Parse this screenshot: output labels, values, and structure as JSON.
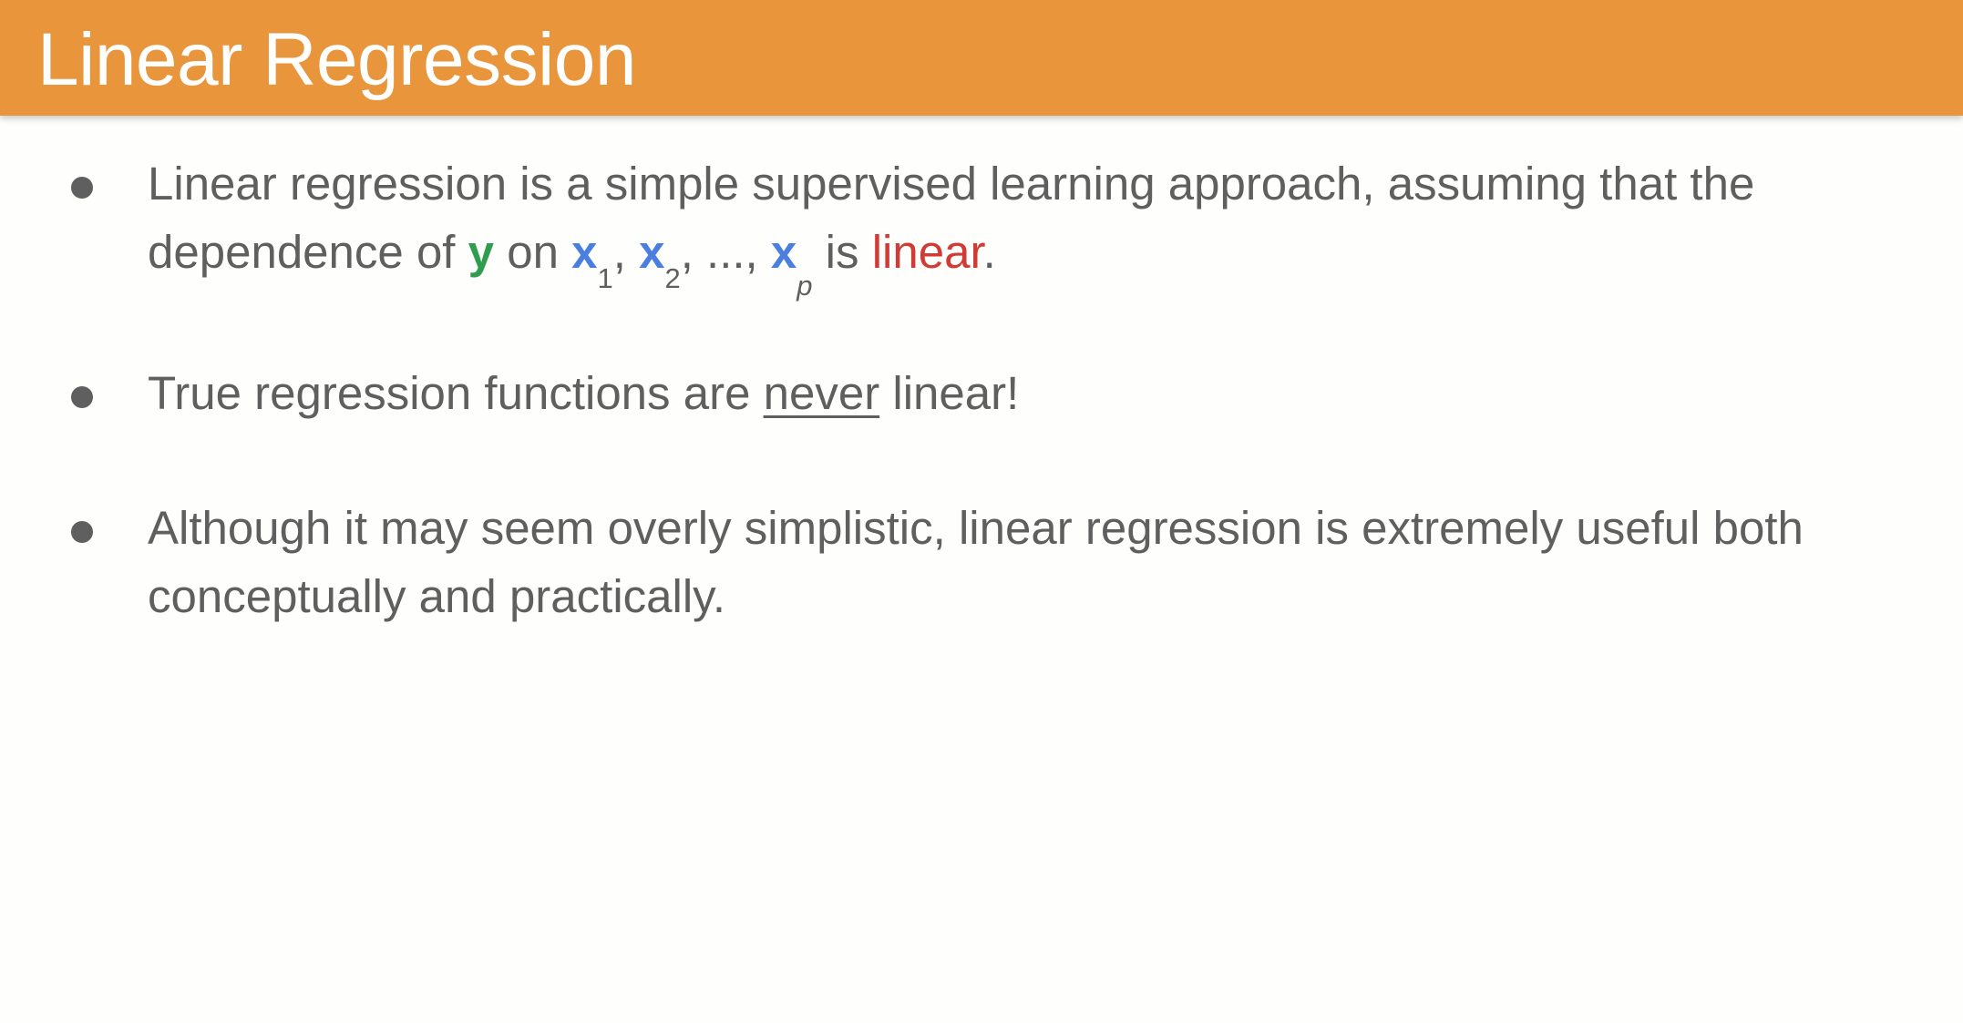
{
  "slide": {
    "title": "Linear Regression"
  },
  "bullets": [
    {
      "part_before_y": "Linear regression is a simple supervised learning approach, assuming that the dependence of ",
      "y": "y",
      "on": " on ",
      "x": "x",
      "sub_1": "1",
      "sep_1": ", ",
      "sub_2": "2",
      "sep_2": ", ..., ",
      "sub_p": "p",
      "is": " is ",
      "linear": "linear",
      "end": "."
    },
    {
      "before": "True regression functions are ",
      "emphasis": "never",
      "after": " linear!"
    },
    {
      "text": "Although it may seem overly simplistic, linear regression is extremely useful both conceptually and practically."
    }
  ],
  "colors": {
    "header": "#e8953b",
    "y_variable": "#2e9d4e",
    "x_variables": "#4a7fe0",
    "linear_word": "#d13b36",
    "body_text": "#5f5f5f"
  }
}
